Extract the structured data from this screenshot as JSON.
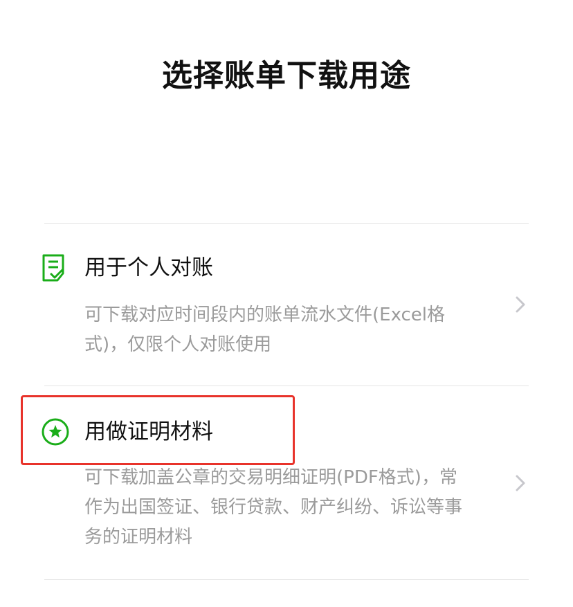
{
  "page": {
    "title": "选择账单下载用途"
  },
  "options": [
    {
      "title": "用于个人对账",
      "description": "可下载对应时间段内的账单流水文件(Excel格式)，仅限个人对账使用",
      "icon": "document-check-icon"
    },
    {
      "title": "用做证明材料",
      "description": "可下载加盖公章的交易明细证明(PDF格式)，常作为出国签证、银行贷款、财产纠纷、诉讼等事务的证明材料",
      "icon": "star-badge-icon"
    }
  ],
  "colors": {
    "accent": "#1aad19",
    "title_text": "#111111",
    "description_text": "#9b9b9b",
    "divider": "#e3e3e3",
    "chevron": "#c7c7cc",
    "highlight": "#e8332b"
  }
}
